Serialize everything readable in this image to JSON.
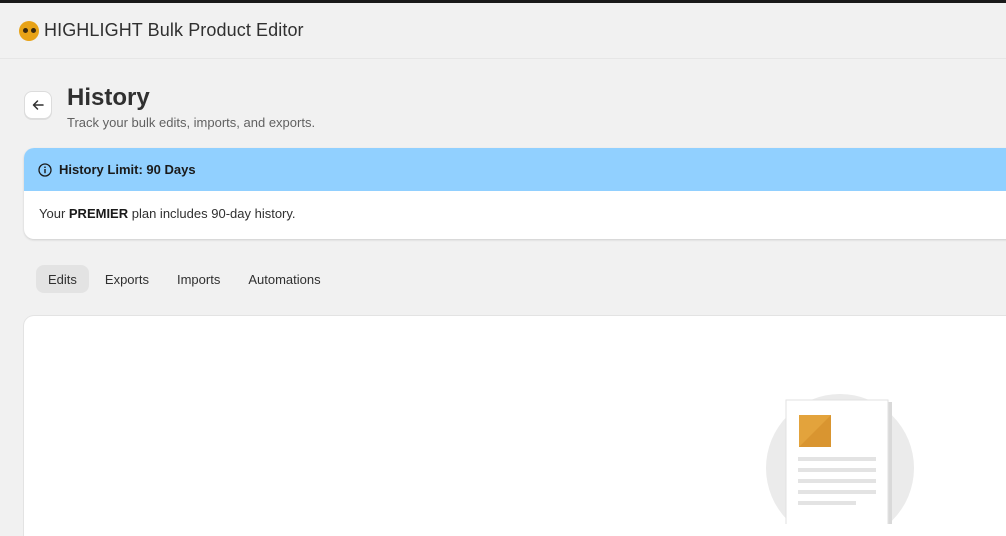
{
  "app": {
    "title": "HIGHLIGHT Bulk Product Editor",
    "logo_icon": "highlight-logo-icon"
  },
  "page": {
    "title": "History",
    "subtitle": "Track your bulk edits, imports, and exports.",
    "back_icon": "arrow-left-icon"
  },
  "banner": {
    "title": "History Limit: 90 Days",
    "body_prefix": "Your ",
    "plan_name": "PREMIER",
    "body_suffix": " plan includes 90-day history.",
    "icon": "info-icon",
    "color": "#91d0ff"
  },
  "tabs": [
    {
      "label": "Edits",
      "active": true
    },
    {
      "label": "Exports",
      "active": false
    },
    {
      "label": "Imports",
      "active": false
    },
    {
      "label": "Automations",
      "active": false
    }
  ],
  "empty_state": {
    "illustration": "document-empty-state-icon",
    "accent_color": "#e3a33c"
  }
}
